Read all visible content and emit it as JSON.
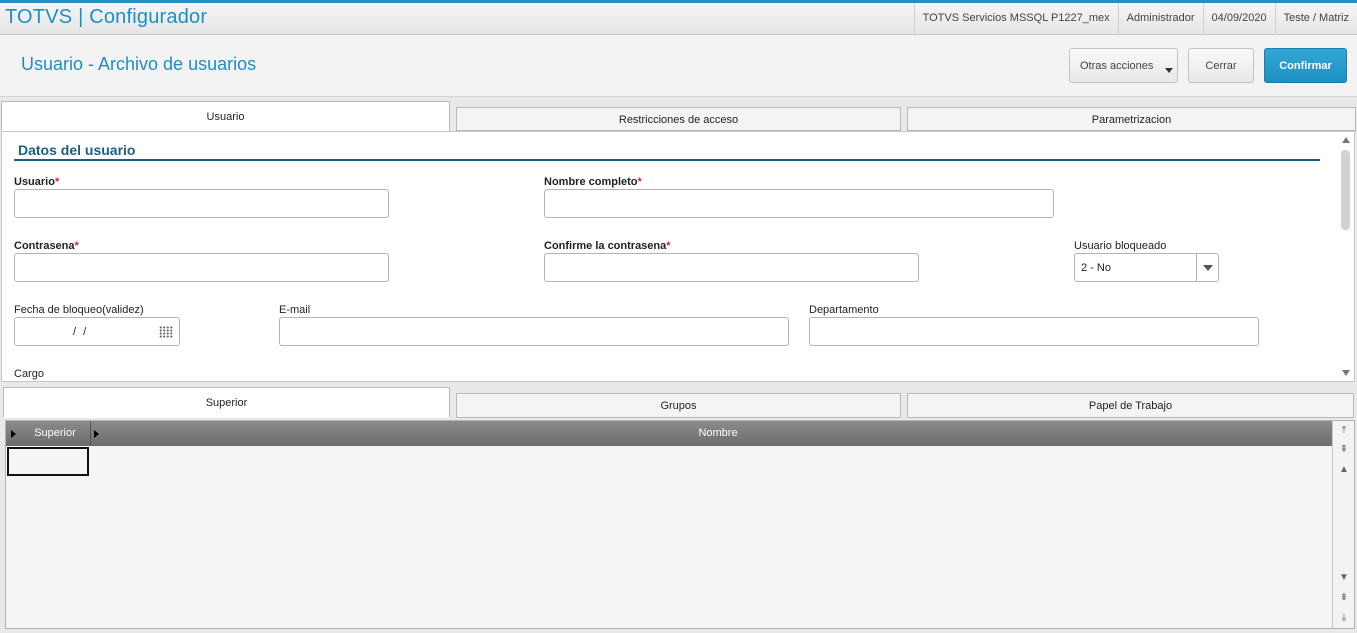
{
  "app": {
    "brand": "TOTVS | Configurador",
    "environment": "TOTVS Servicios MSSQL P1227_mex",
    "user": "Administrador",
    "date": "04/09/2020",
    "branch": "Teste / Matriz"
  },
  "header": {
    "title": "Usuario - Archivo de usuarios",
    "other_actions_label": "Otras acciones",
    "close_label": "Cerrar",
    "confirm_label": "Confirmar"
  },
  "tabs": [
    {
      "label": "Usuario",
      "active": true
    },
    {
      "label": "Restricciones de acceso",
      "active": false
    },
    {
      "label": "Parametrizacion",
      "active": false
    }
  ],
  "form": {
    "section_title": "Datos del usuario",
    "required_mark": "*",
    "usuario": {
      "label": "Usuario",
      "value": ""
    },
    "nombre_completo": {
      "label": "Nombre completo",
      "value": ""
    },
    "contrasena": {
      "label": "Contrasena",
      "value": ""
    },
    "confirme_contrasena": {
      "label": "Confirme la contrasena",
      "value": ""
    },
    "usuario_bloqueado": {
      "label": "Usuario bloqueado",
      "value": "2 - No"
    },
    "fecha_bloqueo": {
      "label": "Fecha de bloqueo(validez)",
      "value": "/ /"
    },
    "email": {
      "label": "E-mail",
      "value": ""
    },
    "departamento": {
      "label": "Departamento",
      "value": ""
    },
    "cargo": {
      "label": "Cargo"
    }
  },
  "sub_tabs": [
    {
      "label": "Superior",
      "active": true
    },
    {
      "label": "Grupos",
      "active": false
    },
    {
      "label": "Papel de Trabajo",
      "active": false
    }
  ],
  "grid": {
    "columns": [
      "Superior",
      "Nombre"
    ],
    "rows": []
  },
  "colors": {
    "accent": "#1d8fc4",
    "primary_button": "#1e8ec2",
    "section_title": "#1b5f84",
    "required": "#dd2222"
  }
}
